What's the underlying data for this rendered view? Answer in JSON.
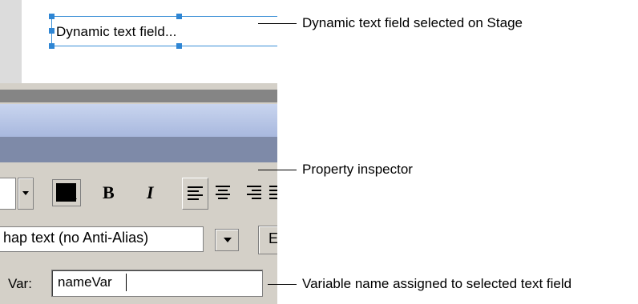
{
  "stage": {
    "text_field_content": "Dynamic text field..."
  },
  "inspector": {
    "bold_label": "B",
    "italic_label": "I",
    "anti_alias_value": "hap text (no Anti-Alias)",
    "edit_button_label": "E",
    "var_label": "Var:",
    "var_value": "nameVar"
  },
  "callouts": {
    "stage_selection": "Dynamic text field selected on Stage",
    "property_inspector": "Property inspector",
    "variable_name": "Variable name assigned to selected text field"
  },
  "colors": {
    "selection": "#2f86d4",
    "panel": "#d4d0c8",
    "title_bar": "#7e8aa8"
  }
}
